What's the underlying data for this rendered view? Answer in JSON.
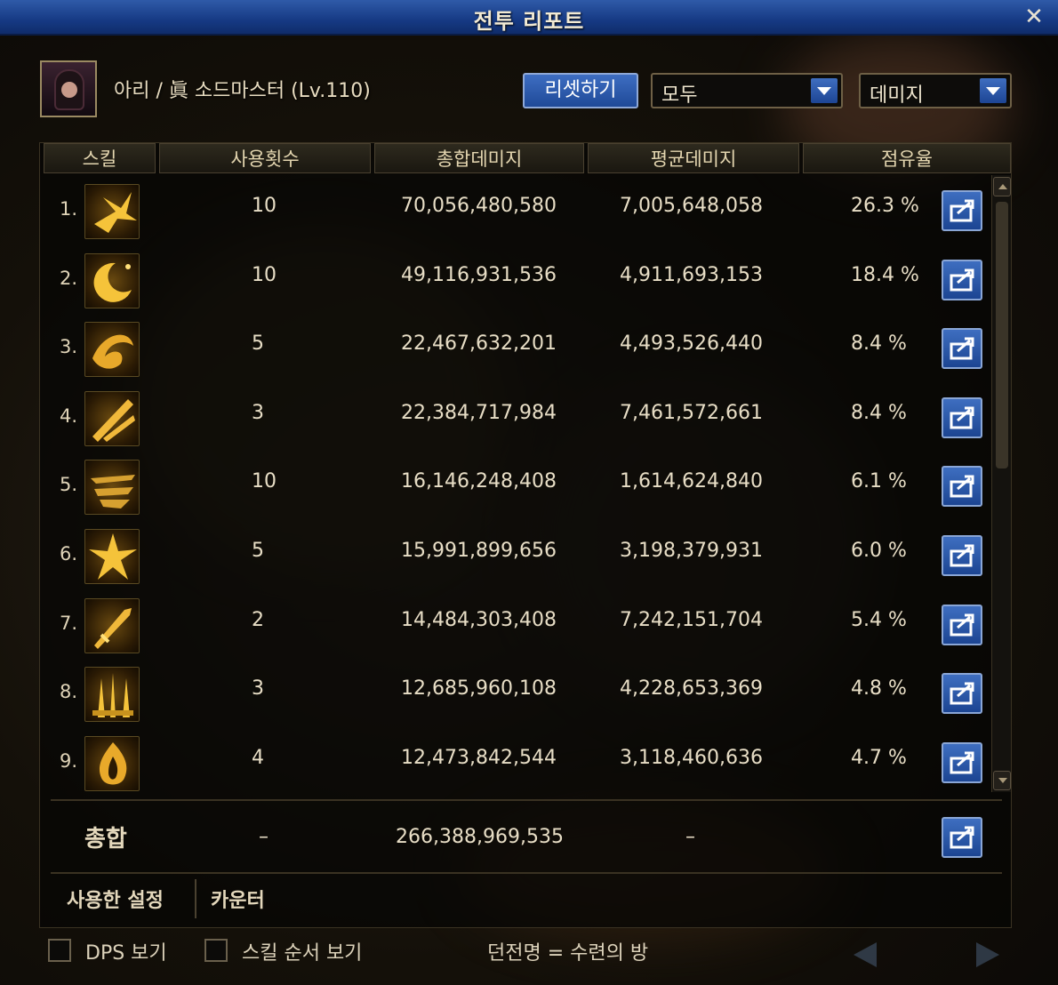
{
  "window": {
    "title": "전투 리포트",
    "close_icon": "close-icon"
  },
  "character": {
    "name": "아리 / 眞 소드마스터 (Lv.110)"
  },
  "controls": {
    "reset_label": "리셋하기",
    "filter_value": "모두",
    "metric_value": "데미지"
  },
  "table": {
    "headers": [
      "스킬",
      "사용횟수",
      "총합데미지",
      "평균데미지",
      "점유율"
    ],
    "rows": [
      {
        "rank": "1.",
        "icon": "burst-icon",
        "count": "10",
        "total": "70,056,480,580",
        "avg": "7,005,648,058",
        "share": "26.3 %"
      },
      {
        "rank": "2.",
        "icon": "moon-icon",
        "count": "10",
        "total": "49,116,931,536",
        "avg": "4,911,693,153",
        "share": "18.4 %"
      },
      {
        "rank": "3.",
        "icon": "swirl-icon",
        "count": "5",
        "total": "22,467,632,201",
        "avg": "4,493,526,440",
        "share": "8.4 %"
      },
      {
        "rank": "4.",
        "icon": "slash-icon",
        "count": "3",
        "total": "22,384,717,984",
        "avg": "7,461,572,661",
        "share": "8.4 %"
      },
      {
        "rank": "5.",
        "icon": "dash-icon",
        "count": "10",
        "total": "16,146,248,408",
        "avg": "1,614,624,840",
        "share": "6.1 %"
      },
      {
        "rank": "6.",
        "icon": "star-icon",
        "count": "5",
        "total": "15,991,899,656",
        "avg": "3,198,379,931",
        "share": "6.0 %"
      },
      {
        "rank": "7.",
        "icon": "sword-icon",
        "count": "2",
        "total": "14,484,303,408",
        "avg": "7,242,151,704",
        "share": "5.4 %"
      },
      {
        "rank": "8.",
        "icon": "swords-icon",
        "count": "3",
        "total": "12,685,960,108",
        "avg": "4,228,653,369",
        "share": "4.8 %"
      },
      {
        "rank": "9.",
        "icon": "flame-icon",
        "count": "4",
        "total": "12,473,842,544",
        "avg": "3,118,460,636",
        "share": "4.7 %"
      }
    ],
    "total": {
      "label": "총합",
      "count": "–",
      "total": "266,388,969,535",
      "avg": "–"
    }
  },
  "tabs": {
    "used_settings": "사용한 설정",
    "counter": "카운터"
  },
  "footer": {
    "dps_label": "DPS 보기",
    "skill_order_label": "스킬 순서 보기",
    "dungeon_label": "던전명 = 수련의 방"
  },
  "colors": {
    "accent": "#2f5aa8",
    "button": "#1f4a98",
    "text": "#e8dec6",
    "panel": "#0b0a08"
  }
}
